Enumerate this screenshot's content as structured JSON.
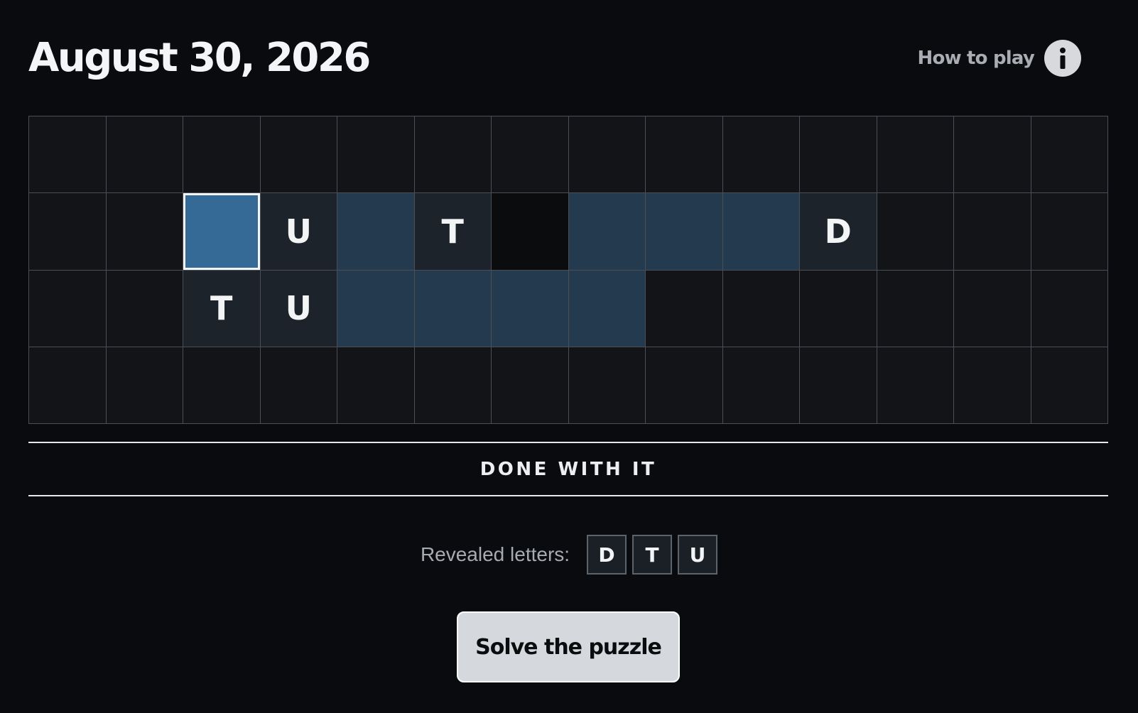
{
  "header": {
    "title": "August 30, 2026",
    "how_to_play_label": "How to play",
    "info_icon": "info-icon"
  },
  "board": {
    "rows": 4,
    "cols": 14,
    "cells": [
      [
        "",
        "",
        "",
        "",
        "",
        "",
        "",
        "",
        "",
        "",
        "",
        "",
        "",
        ""
      ],
      [
        "",
        "",
        "",
        "U",
        "",
        "T",
        "",
        "",
        "",
        "",
        "D",
        "",
        "",
        ""
      ],
      [
        "",
        "",
        "T",
        "U",
        "",
        "",
        "",
        "",
        "",
        "",
        "",
        "",
        "",
        ""
      ],
      [
        "",
        "",
        "",
        "",
        "",
        "",
        "",
        "",
        "",
        "",
        "",
        "",
        "",
        ""
      ]
    ],
    "states": [
      [
        "empty",
        "empty",
        "empty",
        "empty",
        "empty",
        "empty",
        "empty",
        "empty",
        "empty",
        "empty",
        "empty",
        "empty",
        "empty",
        "empty"
      ],
      [
        "empty",
        "empty",
        "selected",
        "revealed",
        "word",
        "revealed",
        "gap",
        "word",
        "word",
        "word",
        "revealed",
        "empty",
        "empty",
        "empty"
      ],
      [
        "empty",
        "empty",
        "revealed",
        "revealed",
        "word",
        "word",
        "word",
        "word",
        "empty",
        "empty",
        "empty",
        "empty",
        "empty",
        "empty"
      ],
      [
        "empty",
        "empty",
        "empty",
        "empty",
        "empty",
        "empty",
        "empty",
        "empty",
        "empty",
        "empty",
        "empty",
        "empty",
        "empty",
        "empty"
      ]
    ]
  },
  "clue": "DONE WITH IT",
  "revealed": {
    "label": "Revealed letters:",
    "letters": [
      "D",
      "T",
      "U"
    ]
  },
  "actions": {
    "solve_label": "Solve the puzzle"
  },
  "colors": {
    "background": "#090b0e",
    "cell": "#121418",
    "word_cell": "#233a4f",
    "revealed_cell": "#1c232b",
    "selected_cell": "#356a96",
    "grid_line": "#4b4f55",
    "button": "#d5d8dd"
  }
}
